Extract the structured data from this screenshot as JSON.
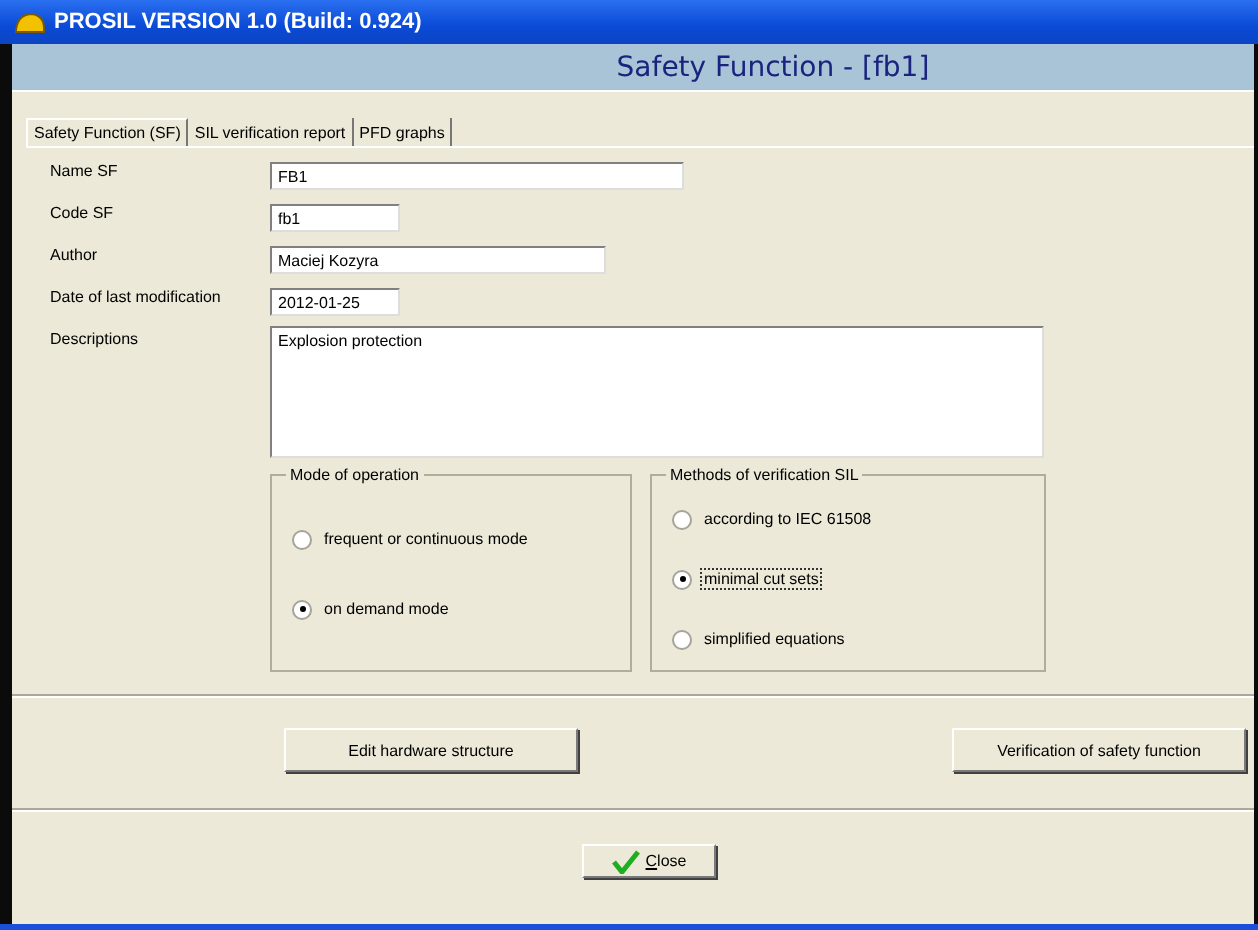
{
  "window": {
    "title": "PROSIL VERSION 1.0 (Build: 0.924)"
  },
  "header": {
    "title": "Safety Function - [fb1]"
  },
  "tabs": [
    {
      "label": "Safety Function (SF)",
      "selected": true
    },
    {
      "label": "SIL verification report",
      "selected": false
    },
    {
      "label": "PFD graphs",
      "selected": false
    }
  ],
  "fields": [
    {
      "label": "Name SF",
      "value": "FB1",
      "kind": "long"
    },
    {
      "label": "Code SF",
      "value": "fb1",
      "kind": "short"
    },
    {
      "label": "Author",
      "value": "Maciej Kozyra",
      "kind": "medium"
    },
    {
      "label": "Date of last modification",
      "value": "2012-01-25",
      "kind": "short"
    },
    {
      "label": "Descriptions",
      "value": "Explosion protection",
      "kind": "multiline"
    }
  ],
  "groups": [
    {
      "title": "Mode of operation",
      "options": [
        {
          "label": "frequent or continuous mode",
          "selected": false,
          "focused": false
        },
        {
          "label": "on demand mode",
          "selected": true,
          "focused": false
        }
      ]
    },
    {
      "title": "Methods of verification SIL",
      "options": [
        {
          "label": "according to IEC 61508",
          "selected": false,
          "focused": false
        },
        {
          "label": "minimal cut sets",
          "selected": true,
          "focused": true
        },
        {
          "label": "simplified equations",
          "selected": false,
          "focused": false
        }
      ]
    }
  ],
  "buttons": [
    "Edit hardware structure",
    "Verification of safety function"
  ],
  "close_button": "Close"
}
